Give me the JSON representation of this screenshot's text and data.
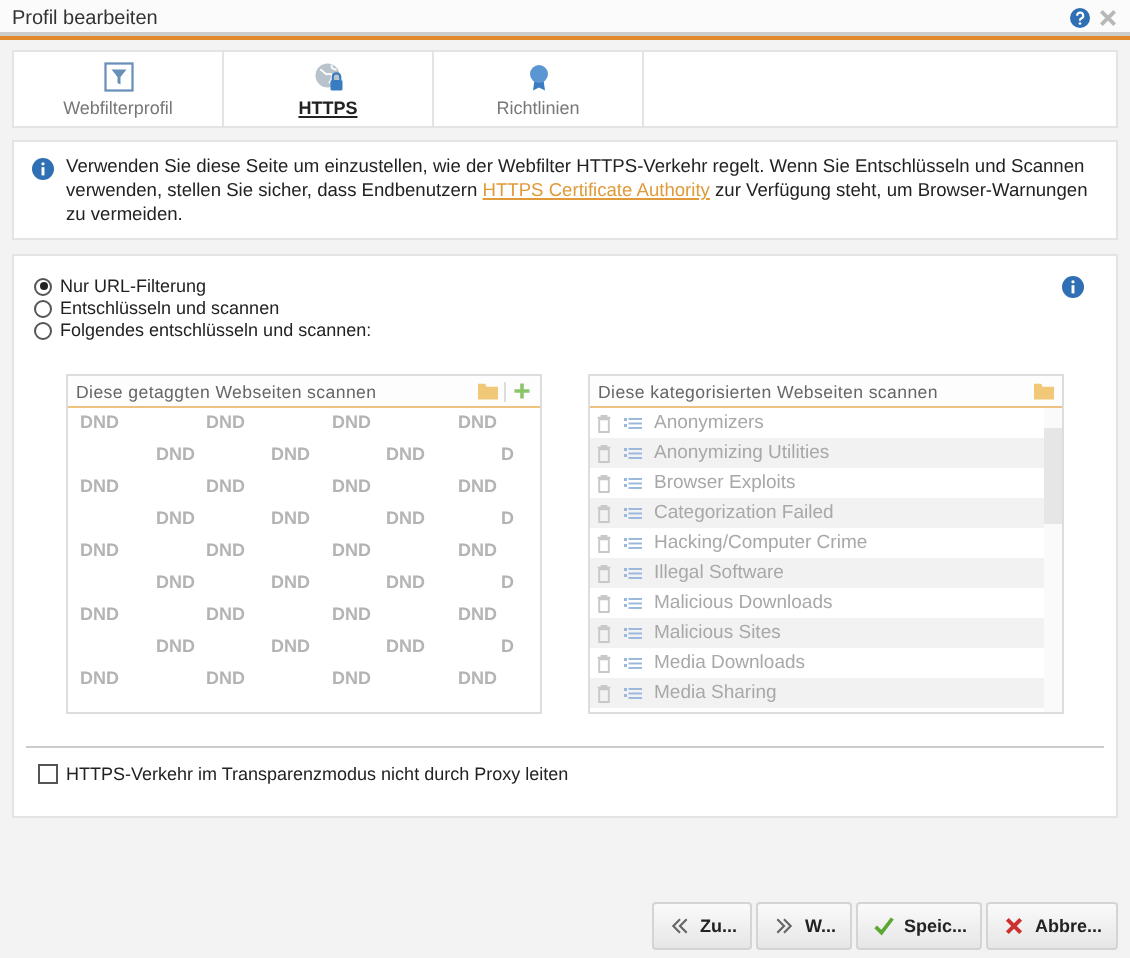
{
  "window": {
    "title": "Profil bearbeiten"
  },
  "tabs": [
    {
      "label": "Webfilterprofil",
      "selected": false
    },
    {
      "label": "HTTPS",
      "selected": true
    },
    {
      "label": "Richtlinien",
      "selected": false
    }
  ],
  "info": {
    "before": "Verwenden Sie diese Seite um einzustellen, wie der Webfilter HTTPS-Verkehr regelt. Wenn Sie Entschlüsseln und Scannen verwenden, stellen Sie sicher, dass Endbenutzern ",
    "link": "HTTPS Certificate Authority",
    "after": " zur Verfügung steht, um Browser-Warnungen zu vermeiden."
  },
  "modes": [
    {
      "label": "Nur URL-Filterung",
      "selected": true
    },
    {
      "label": "Entschlüsseln und scannen",
      "selected": false
    },
    {
      "label": "Folgendes entschlüsseln und scannen:",
      "selected": false
    }
  ],
  "tagged_list": {
    "title": "Diese getaggten Webseiten scannen",
    "disabled": true,
    "dnd_rows": [
      [
        "DND",
        "DND",
        "DND",
        "DND"
      ],
      [
        "DND",
        "DND",
        "DND",
        "D"
      ],
      [
        "DND",
        "DND",
        "DND",
        "DND"
      ],
      [
        "DND",
        "DND",
        "DND",
        "D"
      ],
      [
        "DND",
        "DND",
        "DND",
        "DND"
      ],
      [
        "DND",
        "DND",
        "DND",
        "D"
      ],
      [
        "DND",
        "DND",
        "DND",
        "DND"
      ],
      [
        "DND",
        "DND",
        "DND",
        "D"
      ],
      [
        "DND",
        "DND",
        "DND",
        "DND"
      ]
    ]
  },
  "category_list": {
    "title": "Diese kategorisierten Webseiten scannen",
    "disabled": true,
    "items": [
      "Anonymizers",
      "Anonymizing Utilities",
      "Browser Exploits",
      "Categorization Failed",
      "Hacking/Computer Crime",
      "Illegal Software",
      "Malicious Downloads",
      "Malicious Sites",
      "Media Downloads",
      "Media Sharing"
    ]
  },
  "bypass_option": {
    "label": "HTTPS-Verkehr im Transparenzmodus nicht durch Proxy leiten",
    "checked": false
  },
  "buttons": [
    {
      "label": "Zu...",
      "kind": "back"
    },
    {
      "label": "W...",
      "kind": "next"
    },
    {
      "label": "Speic...",
      "kind": "save"
    },
    {
      "label": "Abbre...",
      "kind": "cancel"
    }
  ]
}
